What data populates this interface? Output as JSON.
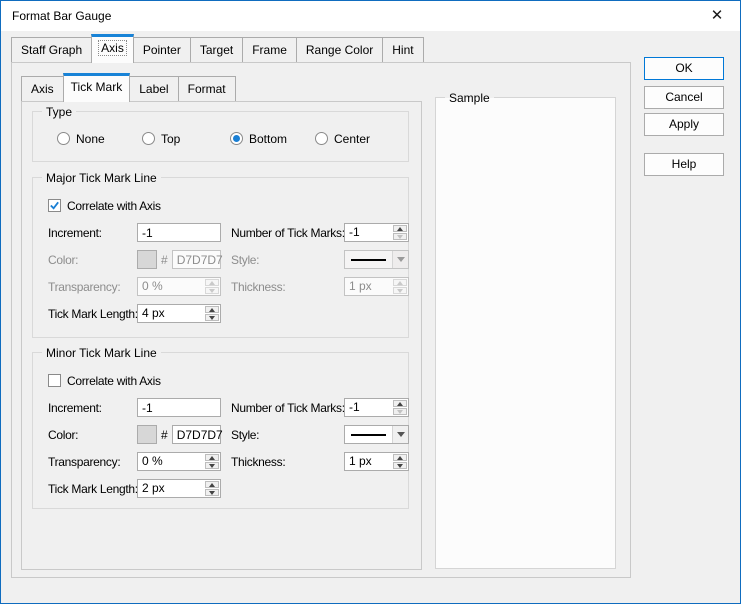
{
  "window": {
    "title": "Format Bar Gauge",
    "close_icon": "✕"
  },
  "tabs": {
    "items": [
      "Staff Graph",
      "Axis",
      "Pointer",
      "Target",
      "Frame",
      "Range Color",
      "Hint"
    ],
    "selected": "Axis"
  },
  "subtabs": {
    "items": [
      "Axis",
      "Tick Mark",
      "Label",
      "Format"
    ],
    "selected": "Tick Mark"
  },
  "type_group": {
    "title": "Type",
    "options": [
      {
        "label": "None",
        "selected": false
      },
      {
        "label": "Top",
        "selected": false
      },
      {
        "label": "Bottom",
        "selected": true
      },
      {
        "label": "Center",
        "selected": false
      }
    ]
  },
  "major": {
    "title": "Major Tick Mark Line",
    "correlate": {
      "label": "Correlate with Axis",
      "checked": true
    },
    "increment": {
      "label": "Increment:",
      "value": "-1",
      "disabled": false
    },
    "num_ticks": {
      "label": "Number of Tick Marks:",
      "value": "-1",
      "disabled": false
    },
    "color": {
      "label": "Color:",
      "hash": "#",
      "value": "D7D7D7",
      "swatch_style": "background-color:#D7D7D7",
      "disabled": true
    },
    "style": {
      "label": "Style:",
      "selected_style": "solid-line",
      "disabled": true
    },
    "transparency": {
      "label": "Transparency:",
      "value": "0 %",
      "disabled": true
    },
    "thickness": {
      "label": "Thickness:",
      "value": "1 px",
      "disabled": true
    },
    "tick_length": {
      "label": "Tick Mark Length:",
      "value": "4 px",
      "disabled": false
    }
  },
  "minor": {
    "title": "Minor Tick Mark Line",
    "correlate": {
      "label": "Correlate with Axis",
      "checked": false
    },
    "increment": {
      "label": "Increment:",
      "value": "-1",
      "disabled": false
    },
    "num_ticks": {
      "label": "Number of Tick Marks:",
      "value": "-1",
      "disabled": false
    },
    "color": {
      "label": "Color:",
      "hash": "#",
      "value": "D7D7D7",
      "swatch_style": "background-color:#D7D7D7",
      "disabled": false
    },
    "style": {
      "label": "Style:",
      "selected_style": "solid-line",
      "disabled": false
    },
    "transparency": {
      "label": "Transparency:",
      "value": "0 %",
      "disabled": false
    },
    "thickness": {
      "label": "Thickness:",
      "value": "1 px",
      "disabled": false
    },
    "tick_length": {
      "label": "Tick Mark Length:",
      "value": "2 px",
      "disabled": false
    }
  },
  "sample": {
    "title": "Sample"
  },
  "action_buttons": {
    "ok": "OK",
    "cancel": "Cancel",
    "apply": "Apply",
    "help": "Help"
  },
  "colors": {
    "accent_tab": "#1883D7",
    "ok_border": "#0078D7",
    "selection_blue": "#1A7FD4",
    "disabled_text": "#8D8D8D",
    "tick_color_value": "#D7D7D7",
    "window_border": "#0F6CBF"
  }
}
